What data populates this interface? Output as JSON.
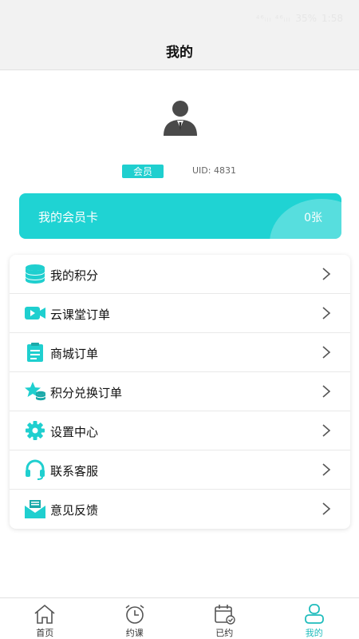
{
  "status_bar": {
    "signal_text": "⁴⁶ᵢₗₗ ⁴⁶ᵢₗₗ",
    "battery": "35%",
    "time": "1:58"
  },
  "header": {
    "title": "我的"
  },
  "profile": {
    "member_badge": "会员",
    "uid": "UID: 4831"
  },
  "member_card": {
    "label": "我的会员卡",
    "count": "0张"
  },
  "menu": {
    "items": [
      {
        "label": "我的积分",
        "icon": "coins-stack-icon"
      },
      {
        "label": "云课堂订单",
        "icon": "video-camera-icon"
      },
      {
        "label": "商城订单",
        "icon": "clipboard-icon"
      },
      {
        "label": "积分兑换订单",
        "icon": "star-coins-icon"
      },
      {
        "label": "设置中心",
        "icon": "gear-icon"
      },
      {
        "label": "联系客服",
        "icon": "headset-icon"
      },
      {
        "label": "意见反馈",
        "icon": "feedback-envelope-icon"
      }
    ]
  },
  "tabbar": {
    "tabs": [
      {
        "label": "首页",
        "icon": "home-icon"
      },
      {
        "label": "约课",
        "icon": "alarm-clock-icon"
      },
      {
        "label": "已约",
        "icon": "calendar-check-icon"
      },
      {
        "label": "我的",
        "icon": "user-icon",
        "active": true
      }
    ]
  },
  "colors": {
    "accent": "#1fd3d3",
    "active_tab": "#1fbcbc"
  }
}
